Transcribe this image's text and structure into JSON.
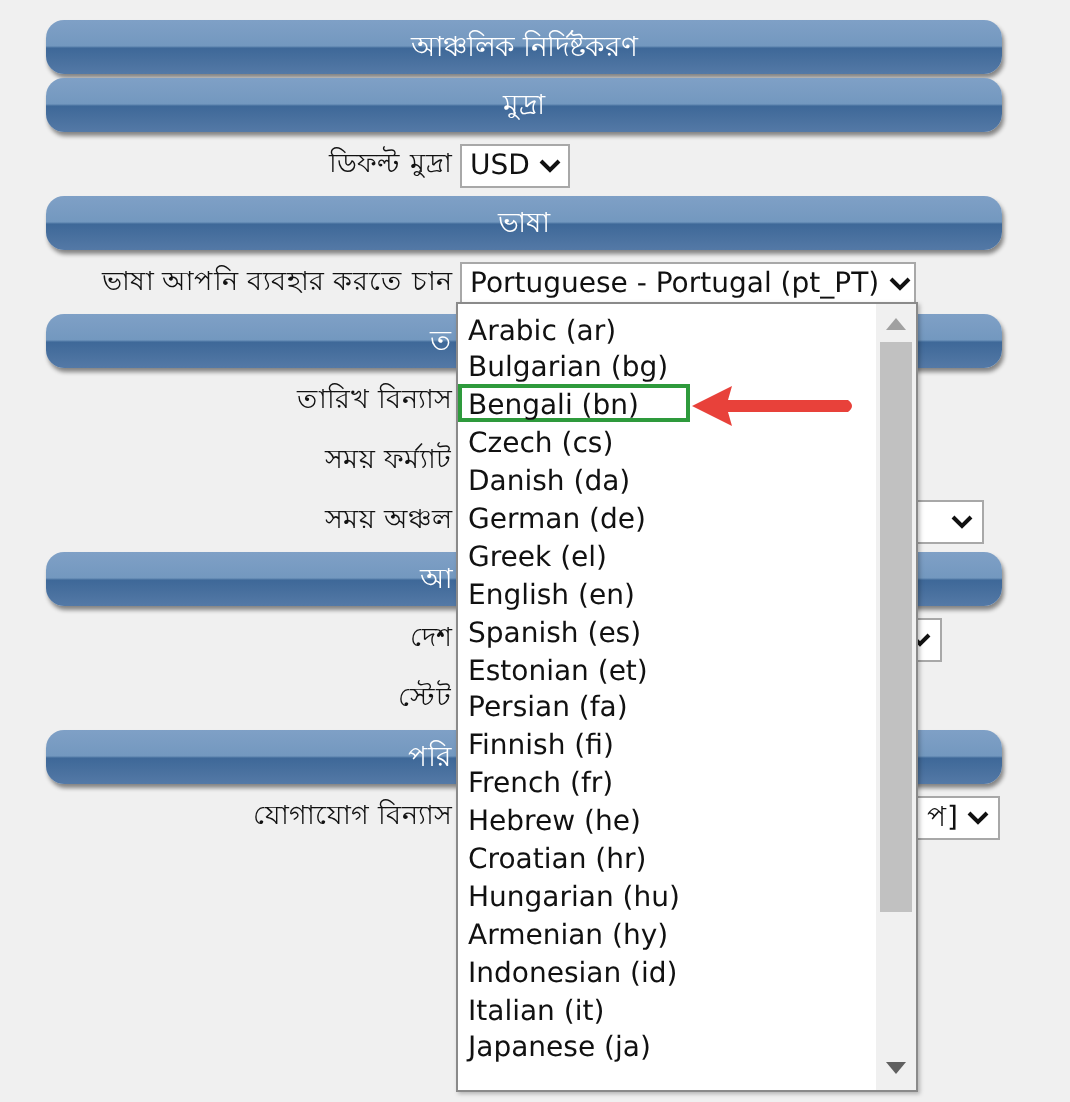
{
  "sections": [
    {
      "title": "আঞ্চলিক নির্দিষ্টকরণ",
      "covered": false
    },
    {
      "title": "মুদ্রা",
      "covered": false,
      "rows": [
        {
          "label": "ডিফল্ট মুদ্রা",
          "kind": "select",
          "value": "USD"
        }
      ]
    },
    {
      "title": "ভাষা",
      "covered": false,
      "rows": [
        {
          "label": "ভাষা আপনি ব্যবহার করতে চান",
          "kind": "select",
          "value": "Portuguese - Portugal (pt_PT)",
          "open": true,
          "options": [
            {
              "label": "Arabic (ar)",
              "highlighted": false
            },
            {
              "label": "Bulgarian (bg)",
              "highlighted": false
            },
            {
              "label": "Bengali (bn)",
              "highlighted": true
            },
            {
              "label": "Czech (cs)",
              "highlighted": false
            },
            {
              "label": "Danish (da)",
              "highlighted": false
            },
            {
              "label": "German (de)",
              "highlighted": false
            },
            {
              "label": "Greek (el)",
              "highlighted": false
            },
            {
              "label": "English (en)",
              "highlighted": false
            },
            {
              "label": "Spanish (es)",
              "highlighted": false
            },
            {
              "label": "Estonian (et)",
              "highlighted": false
            },
            {
              "label": "Persian (fa)",
              "highlighted": false
            },
            {
              "label": "Finnish (fi)",
              "highlighted": false
            },
            {
              "label": "French (fr)",
              "highlighted": false
            },
            {
              "label": "Hebrew (he)",
              "highlighted": false
            },
            {
              "label": "Croatian (hr)",
              "highlighted": false
            },
            {
              "label": "Hungarian (hu)",
              "highlighted": false
            },
            {
              "label": "Armenian (hy)",
              "highlighted": false
            },
            {
              "label": "Indonesian (id)",
              "highlighted": false
            },
            {
              "label": "Italian (it)",
              "highlighted": false
            },
            {
              "label": "Japanese (ja)",
              "highlighted": false
            }
          ]
        }
      ]
    },
    {
      "title": "ত",
      "covered": true,
      "rows": [
        {
          "label": "তারিখ বিন্যাস",
          "kind": "hidden"
        },
        {
          "label": "সময় ফর্ম্যাট",
          "kind": "hidden"
        },
        {
          "label": "সময় অঞ্চল",
          "kind": "select"
        }
      ]
    },
    {
      "title": "আ",
      "covered": true,
      "rows": [
        {
          "label": "দেশ",
          "kind": "select"
        },
        {
          "label": "স্টেট",
          "kind": "hidden"
        }
      ]
    },
    {
      "title": "পরি",
      "covered": true,
      "rows": [
        {
          "label": "যোগাযোগ বিন্যাস",
          "kind": "select",
          "value": "প]"
        }
      ]
    }
  ]
}
